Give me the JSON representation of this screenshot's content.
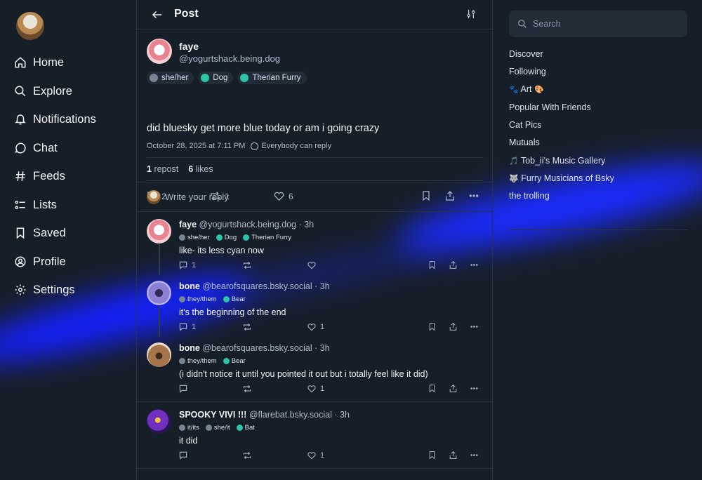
{
  "nav": {
    "items": [
      {
        "label": "Home",
        "icon": "home-icon"
      },
      {
        "label": "Explore",
        "icon": "search-icon"
      },
      {
        "label": "Notifications",
        "icon": "bell-icon"
      },
      {
        "label": "Chat",
        "icon": "chat-icon"
      },
      {
        "label": "Feeds",
        "icon": "hash-icon"
      },
      {
        "label": "Lists",
        "icon": "list-icon"
      },
      {
        "label": "Saved",
        "icon": "bookmark-icon"
      },
      {
        "label": "Profile",
        "icon": "user-circle-icon"
      },
      {
        "label": "Settings",
        "icon": "gear-icon"
      }
    ]
  },
  "header": {
    "title": "Post"
  },
  "main_post": {
    "author_name": "faye",
    "author_handle": "@yogurtshack.being.dog",
    "tags": [
      "she/her",
      "Dog",
      "Therian Furry"
    ],
    "text": "did bluesky get more blue today or am i going crazy",
    "timestamp": "October 28, 2025 at 7:11 PM",
    "reply_setting": "Everybody can reply",
    "reposts_count": "1",
    "reposts_label": "repost",
    "likes_count": "6",
    "likes_label": "likes",
    "reply_count": "2",
    "repost_count": "1",
    "like_count": "6"
  },
  "reply_box": {
    "placeholder": "Write your reply"
  },
  "replies": [
    {
      "name": "faye",
      "handle": "@yogurtshack.being.dog",
      "time": "3h",
      "tags": [
        "she/her",
        "Dog",
        "Therian Furry"
      ],
      "text": "like- its less cyan now",
      "reply_count": "1",
      "like_count": ""
    },
    {
      "name": "bone",
      "handle": "@bearofsquares.bsky.social",
      "time": "3h",
      "tags": [
        "they/them",
        "Bear"
      ],
      "text": "it's the beginning of the end",
      "reply_count": "1",
      "like_count": "1"
    },
    {
      "name": "bone",
      "handle": "@bearofsquares.bsky.social",
      "time": "3h",
      "tags": [
        "they/them",
        "Bear"
      ],
      "text": "(i didn't notice it until you pointed it out but i totally feel like it did)",
      "reply_count": "",
      "like_count": "1"
    },
    {
      "name": "SPOOKY VIVI !!!",
      "handle": "@flarebat.bsky.social",
      "time": "3h",
      "tags": [
        "it/its",
        "she/it",
        "Bat"
      ],
      "text": "it did",
      "reply_count": "",
      "like_count": "1"
    }
  ],
  "right": {
    "search_placeholder": "Search",
    "feeds": [
      {
        "label": "Discover"
      },
      {
        "label": "Following"
      },
      {
        "label": "Art",
        "emoji_before": "🐾",
        "emoji_after": "🎨"
      },
      {
        "label": "Popular With Friends"
      },
      {
        "label": "Cat Pics"
      },
      {
        "label": "Mutuals"
      },
      {
        "label": "Tob_ii's Music Gallery",
        "emoji_before": "🎵"
      },
      {
        "label": "Furry Musicians of Bsky",
        "emoji_before": "🐺"
      },
      {
        "label": "the trolling"
      }
    ]
  },
  "colors": {
    "background": "#161e27",
    "accent_glow": "#1a2bff",
    "muted_text": "#aebbc9"
  }
}
